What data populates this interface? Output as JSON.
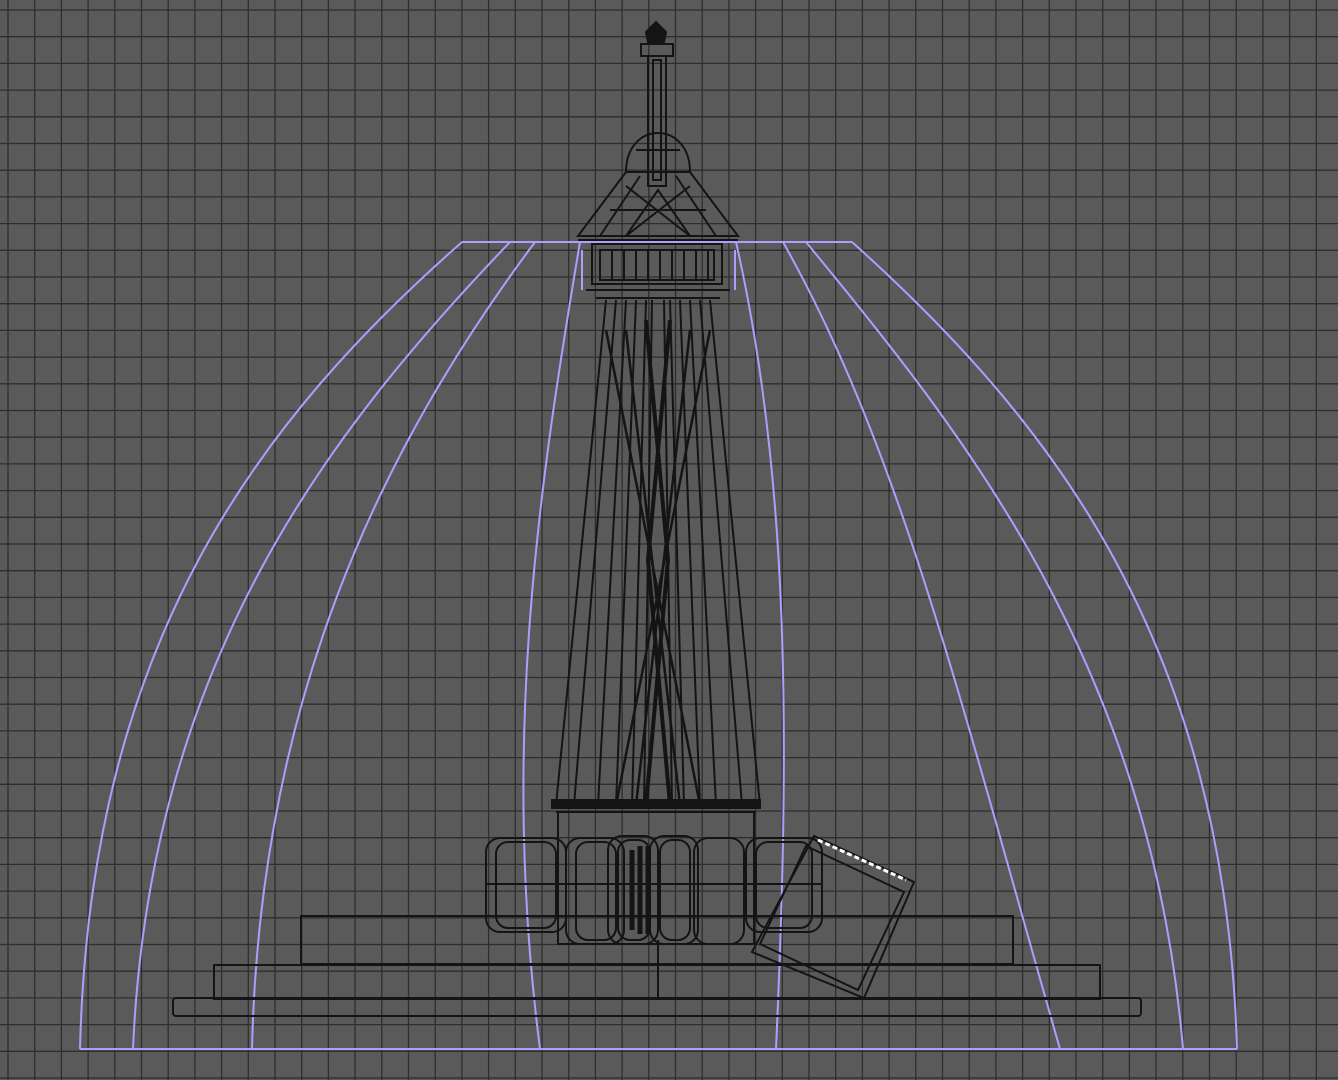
{
  "viewport": {
    "view": "front",
    "shading": "wireframe",
    "grid": true,
    "colors": {
      "background": "#5a5a5a",
      "grid_line": "#2e2e2e",
      "model_wire": "#141414",
      "selected_wire": "#a9a0ff",
      "highlight_wire": "#ffffff"
    }
  }
}
